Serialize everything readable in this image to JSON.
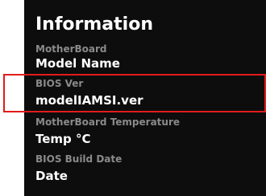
{
  "panel": {
    "title": "Information",
    "items": [
      {
        "label": "MotherBoard",
        "value": "Model Name"
      },
      {
        "label": "BIOS Ver",
        "value": "modelIAMSI.ver"
      },
      {
        "label": "MotherBoard Temperature",
        "value": "Temp °C"
      },
      {
        "label": "BIOS Build Date",
        "value": "Date"
      }
    ]
  },
  "highlight": {
    "item": "BIOS Ver",
    "color": "#e21b1b"
  }
}
